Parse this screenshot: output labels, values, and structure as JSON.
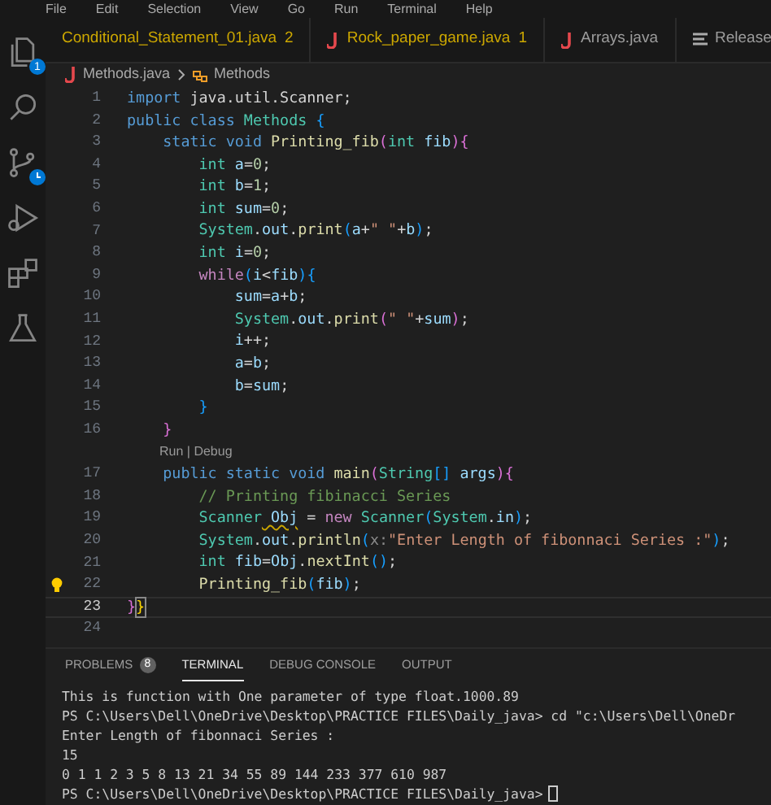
{
  "menu": [
    "File",
    "Edit",
    "Selection",
    "View",
    "Go",
    "Run",
    "Terminal",
    "Help"
  ],
  "activity_bar": [
    {
      "kind": "files",
      "badge": "1"
    },
    {
      "kind": "search"
    },
    {
      "kind": "source-control"
    },
    {
      "kind": "run-debug"
    },
    {
      "kind": "extensions"
    },
    {
      "kind": "testing"
    }
  ],
  "tabs": [
    {
      "label": "Conditional_Statement_01.java",
      "count": "2",
      "kind": "plain",
      "warning": true
    },
    {
      "label": "Rock_paper_game.java",
      "count": "1",
      "kind": "java",
      "warning": true
    },
    {
      "label": "Arrays.java",
      "kind": "java",
      "warning": false
    },
    {
      "label": "Release",
      "kind": "notes",
      "warning": false
    }
  ],
  "breadcrumb": {
    "file": "Methods.java",
    "symbol": "Methods"
  },
  "code": [
    {
      "number": "1",
      "tokens": [
        {
          "kind": "keyword",
          "text": "import"
        },
        {
          "kind": "plain",
          "text": " java.util.Scanner;"
        }
      ]
    },
    {
      "number": "2",
      "tokens": [
        {
          "kind": "keyword",
          "text": "public class"
        },
        {
          "kind": "type",
          "text": " Methods"
        },
        {
          "kind": "bracket",
          "text": " {"
        }
      ]
    },
    {
      "number": "3",
      "tokens": [
        {
          "kind": "keyword",
          "text": "    static void"
        },
        {
          "kind": "fn",
          "text": " Printing_fib"
        },
        {
          "kind": "paren",
          "text": "("
        },
        {
          "kind": "type",
          "text": "int"
        },
        {
          "kind": "var",
          "text": " fib"
        },
        {
          "kind": "paren",
          "text": "){"
        }
      ]
    },
    {
      "number": "4",
      "tokens": [
        {
          "kind": "type",
          "text": "        int"
        },
        {
          "kind": "var",
          "text": " a"
        },
        {
          "kind": "plain",
          "text": "="
        },
        {
          "kind": "number",
          "text": "0"
        },
        {
          "kind": "plain",
          "text": ";"
        }
      ]
    },
    {
      "number": "5",
      "tokens": [
        {
          "kind": "type",
          "text": "        int"
        },
        {
          "kind": "var",
          "text": " b"
        },
        {
          "kind": "plain",
          "text": "="
        },
        {
          "kind": "number",
          "text": "1"
        },
        {
          "kind": "plain",
          "text": ";"
        }
      ]
    },
    {
      "number": "6",
      "tokens": [
        {
          "kind": "type",
          "text": "        int"
        },
        {
          "kind": "var",
          "text": " sum"
        },
        {
          "kind": "plain",
          "text": "="
        },
        {
          "kind": "number",
          "text": "0"
        },
        {
          "kind": "plain",
          "text": ";"
        }
      ]
    },
    {
      "number": "7",
      "tokens": [
        {
          "kind": "type",
          "text": "        System"
        },
        {
          "kind": "plain",
          "text": "."
        },
        {
          "kind": "var",
          "text": "out"
        },
        {
          "kind": "plain",
          "text": "."
        },
        {
          "kind": "fn",
          "text": "print"
        },
        {
          "kind": "bracket",
          "text": "("
        },
        {
          "kind": "var",
          "text": "a"
        },
        {
          "kind": "plain",
          "text": "+"
        },
        {
          "kind": "string",
          "text": "\" \""
        },
        {
          "kind": "plain",
          "text": "+"
        },
        {
          "kind": "var",
          "text": "b"
        },
        {
          "kind": "bracket",
          "text": ")"
        },
        {
          "kind": "plain",
          "text": ";"
        }
      ]
    },
    {
      "number": "8",
      "tokens": [
        {
          "kind": "type",
          "text": "        int"
        },
        {
          "kind": "var",
          "text": " i"
        },
        {
          "kind": "plain",
          "text": "="
        },
        {
          "kind": "number",
          "text": "0"
        },
        {
          "kind": "plain",
          "text": ";"
        }
      ]
    },
    {
      "number": "9",
      "tokens": [
        {
          "kind": "control",
          "text": "        while"
        },
        {
          "kind": "bracket",
          "text": "("
        },
        {
          "kind": "var",
          "text": "i"
        },
        {
          "kind": "plain",
          "text": "<"
        },
        {
          "kind": "var",
          "text": "fib"
        },
        {
          "kind": "bracket",
          "text": "){"
        }
      ]
    },
    {
      "number": "10",
      "tokens": [
        {
          "kind": "var",
          "text": "            sum"
        },
        {
          "kind": "plain",
          "text": "="
        },
        {
          "kind": "var",
          "text": "a"
        },
        {
          "kind": "plain",
          "text": "+"
        },
        {
          "kind": "var",
          "text": "b"
        },
        {
          "kind": "plain",
          "text": ";"
        }
      ]
    },
    {
      "number": "11",
      "tokens": [
        {
          "kind": "type",
          "text": "            System"
        },
        {
          "kind": "plain",
          "text": "."
        },
        {
          "kind": "var",
          "text": "out"
        },
        {
          "kind": "plain",
          "text": "."
        },
        {
          "kind": "fn",
          "text": "print"
        },
        {
          "kind": "paren",
          "text": "("
        },
        {
          "kind": "string",
          "text": "\" \""
        },
        {
          "kind": "plain",
          "text": "+"
        },
        {
          "kind": "var",
          "text": "sum"
        },
        {
          "kind": "paren",
          "text": ")"
        },
        {
          "kind": "plain",
          "text": ";"
        }
      ]
    },
    {
      "number": "12",
      "tokens": [
        {
          "kind": "var",
          "text": "            i"
        },
        {
          "kind": "plain",
          "text": "++;"
        }
      ]
    },
    {
      "number": "13",
      "tokens": [
        {
          "kind": "var",
          "text": "            a"
        },
        {
          "kind": "plain",
          "text": "="
        },
        {
          "kind": "var",
          "text": "b"
        },
        {
          "kind": "plain",
          "text": ";"
        }
      ]
    },
    {
      "number": "14",
      "tokens": [
        {
          "kind": "var",
          "text": "            b"
        },
        {
          "kind": "plain",
          "text": "="
        },
        {
          "kind": "var",
          "text": "sum"
        },
        {
          "kind": "plain",
          "text": ";"
        }
      ]
    },
    {
      "number": "15",
      "tokens": [
        {
          "kind": "bracket",
          "text": "        }"
        }
      ]
    },
    {
      "number": "16",
      "tokens": [
        {
          "kind": "paren",
          "text": "    }"
        }
      ]
    },
    {
      "kind": "codelens",
      "text": "Run | Debug"
    },
    {
      "number": "17",
      "tokens": [
        {
          "kind": "keyword",
          "text": "    public static void"
        },
        {
          "kind": "fn",
          "text": " main"
        },
        {
          "kind": "paren",
          "text": "("
        },
        {
          "kind": "type",
          "text": "String"
        },
        {
          "kind": "bracket",
          "text": "[]"
        },
        {
          "kind": "var",
          "text": " args"
        },
        {
          "kind": "paren",
          "text": "){"
        }
      ]
    },
    {
      "number": "18",
      "tokens": [
        {
          "kind": "comment",
          "text": "        // Printing fibinacci Series"
        }
      ]
    },
    {
      "number": "19",
      "tokens": [
        {
          "kind": "type",
          "text": "        Scanner"
        },
        {
          "kind": "squiggle",
          "text": " Obj"
        },
        {
          "kind": "plain",
          "text": " = "
        },
        {
          "kind": "control",
          "text": "new"
        },
        {
          "kind": "type",
          "text": " Scanner"
        },
        {
          "kind": "bracket",
          "text": "("
        },
        {
          "kind": "type",
          "text": "System"
        },
        {
          "kind": "plain",
          "text": "."
        },
        {
          "kind": "var",
          "text": "in"
        },
        {
          "kind": "bracket",
          "text": ")"
        },
        {
          "kind": "plain",
          "text": ";"
        }
      ]
    },
    {
      "number": "20",
      "tokens": [
        {
          "kind": "type",
          "text": "        System"
        },
        {
          "kind": "plain",
          "text": "."
        },
        {
          "kind": "var",
          "text": "out"
        },
        {
          "kind": "plain",
          "text": "."
        },
        {
          "kind": "fn",
          "text": "println"
        },
        {
          "kind": "bracket",
          "text": "("
        },
        {
          "kind": "hint",
          "text": "x:"
        },
        {
          "kind": "string",
          "text": "\"Enter Length of fibonnaci Series :\""
        },
        {
          "kind": "bracket",
          "text": ")"
        },
        {
          "kind": "plain",
          "text": ";"
        }
      ]
    },
    {
      "number": "21",
      "tokens": [
        {
          "kind": "type",
          "text": "        int"
        },
        {
          "kind": "var",
          "text": " fib"
        },
        {
          "kind": "plain",
          "text": "="
        },
        {
          "kind": "var",
          "text": "Obj"
        },
        {
          "kind": "plain",
          "text": "."
        },
        {
          "kind": "fn",
          "text": "nextInt"
        },
        {
          "kind": "bracket",
          "text": "()"
        },
        {
          "kind": "plain",
          "text": ";"
        }
      ]
    },
    {
      "number": "22",
      "lightbulb": true,
      "tokens": [
        {
          "kind": "fn",
          "text": "        Printing_fib"
        },
        {
          "kind": "bracket",
          "text": "("
        },
        {
          "kind": "var",
          "text": "fib"
        },
        {
          "kind": "bracket",
          "text": ")"
        },
        {
          "kind": "plain",
          "text": ";"
        }
      ]
    },
    {
      "number": "23",
      "current": true,
      "tokens": [
        {
          "kind": "paren",
          "text": "}"
        },
        {
          "kind": "matched",
          "text": "}"
        }
      ]
    },
    {
      "number": "24"
    }
  ],
  "panel_tabs": [
    {
      "label": "PROBLEMS",
      "count": "8",
      "selected": false
    },
    {
      "label": "TERMINAL",
      "selected": true
    },
    {
      "label": "DEBUG CONSOLE",
      "selected": false
    },
    {
      "label": "OUTPUT",
      "selected": false
    }
  ],
  "terminal": [
    "This is function with One parameter of type float.1000.89",
    "PS C:\\Users\\Dell\\OneDrive\\Desktop\\PRACTICE FILES\\Daily_java> cd \"c:\\Users\\Dell\\OneDr",
    "Enter Length of fibonnaci Series :",
    "15",
    "0 1 1 2 3 5 8 13 21 34 55 89 144 233 377 610 987",
    "PS C:\\Users\\Dell\\OneDrive\\Desktop\\PRACTICE FILES\\Daily_java>"
  ],
  "terminal_cursor": true
}
